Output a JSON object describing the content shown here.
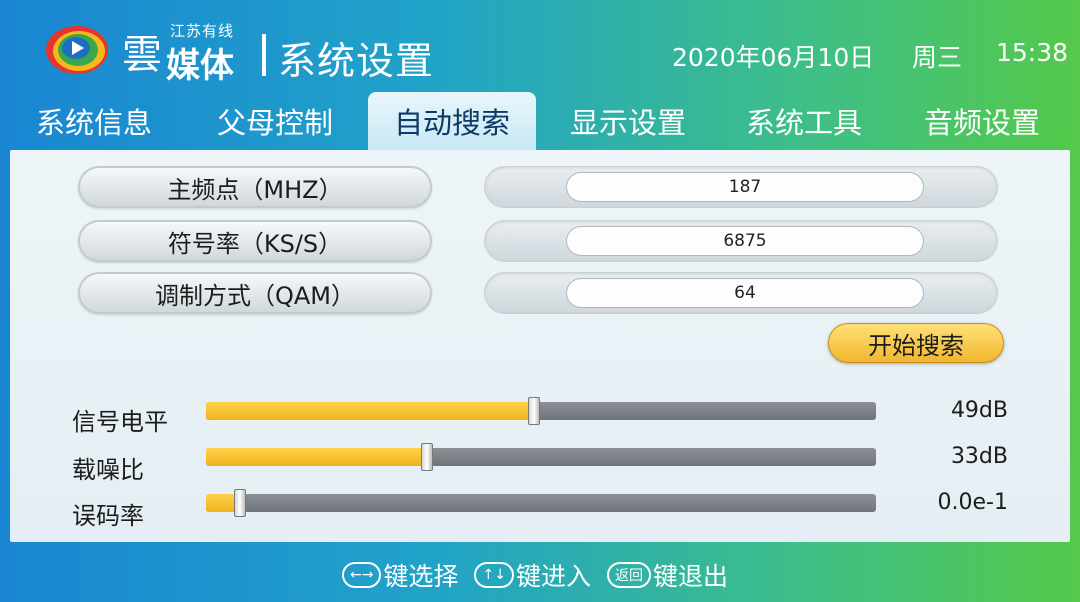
{
  "header": {
    "logo_sub": "江苏有线",
    "logo_main": "媒体",
    "logo_flourish": "雲",
    "title": "系统设置",
    "date": "2020年06月10日",
    "weekday": "周三",
    "time": "15:38"
  },
  "tabs": [
    {
      "label": "系统信息",
      "active": false
    },
    {
      "label": "父母控制",
      "active": false
    },
    {
      "label": "自动搜索",
      "active": true
    },
    {
      "label": "显示设置",
      "active": false
    },
    {
      "label": "系统工具",
      "active": false
    },
    {
      "label": "音频设置",
      "active": false
    }
  ],
  "params": [
    {
      "label": "主频点（MHZ）",
      "value": "187"
    },
    {
      "label": "符号率（KS/S）",
      "value": "6875"
    },
    {
      "label": "调制方式（QAM）",
      "value": "64"
    }
  ],
  "search_button": "开始搜索",
  "meters": [
    {
      "label": "信号电平",
      "value_text": "49dB",
      "level": 0.49
    },
    {
      "label": "载噪比",
      "value_text": "33dB",
      "level": 0.33
    },
    {
      "label": "误码率",
      "value_text": "0.0e-1",
      "level": 0.05
    }
  ],
  "footer": [
    {
      "icon": "left-right-arrows-icon",
      "key": "←→",
      "text": "键选择"
    },
    {
      "icon": "up-down-arrows-icon",
      "key": "↑↓",
      "text": "键进入"
    },
    {
      "icon": "back-key-icon",
      "key": "返回",
      "text": "键退出"
    }
  ],
  "colors": {
    "accent_yellow": "#f0b21d",
    "bg_blue": "#1a86d2",
    "bg_green": "#54c94a"
  }
}
